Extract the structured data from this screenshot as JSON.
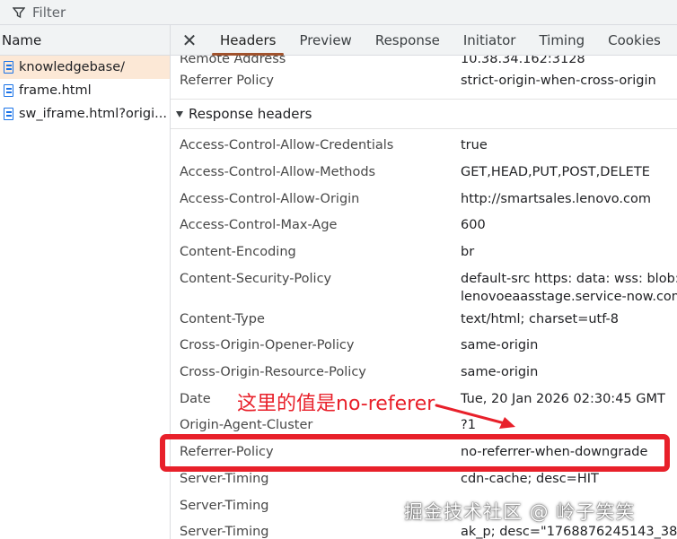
{
  "filter": {
    "placeholder": "Filter"
  },
  "requests": {
    "header": "Name",
    "items": [
      {
        "label": "knowledgebase/"
      },
      {
        "label": "frame.html"
      },
      {
        "label": "sw_iframe.html?origi..."
      }
    ]
  },
  "tabs": [
    "Headers",
    "Preview",
    "Response",
    "Initiator",
    "Timing",
    "Cookies"
  ],
  "general": [
    {
      "name": "Remote Address",
      "value": "10.38.34.162:3128"
    },
    {
      "name": "Referrer Policy",
      "value": "strict-origin-when-cross-origin"
    }
  ],
  "response_section": {
    "title": "Response headers"
  },
  "response_headers": [
    {
      "name": "Access-Control-Allow-Credentials",
      "value": "true"
    },
    {
      "name": "Access-Control-Allow-Methods",
      "value": "GET,HEAD,PUT,POST,DELETE"
    },
    {
      "name": "Access-Control-Allow-Origin",
      "value": "http://smartsales.lenovo.com"
    },
    {
      "name": "Access-Control-Max-Age",
      "value": "600"
    },
    {
      "name": "Content-Encoding",
      "value": "br"
    },
    {
      "name": "Content-Security-Policy",
      "value": "default-src https: data: wss: blob: '",
      "value2": "lenovoeaasstage.service-now.com"
    },
    {
      "name": "Content-Type",
      "value": "text/html; charset=utf-8"
    },
    {
      "name": "Cross-Origin-Opener-Policy",
      "value": "same-origin"
    },
    {
      "name": "Cross-Origin-Resource-Policy",
      "value": "same-origin"
    },
    {
      "name": "Date",
      "value": "Tue, 20 Jan 2026 02:30:45 GMT"
    },
    {
      "name": "Origin-Agent-Cluster",
      "value": "?1"
    },
    {
      "name": "Referrer-Policy",
      "value": "no-referrer-when-downgrade"
    },
    {
      "name": "Server-Timing",
      "value": "cdn-cache; desc=HIT"
    },
    {
      "name": "Server-Timing",
      "value": ""
    },
    {
      "name": "Server-Timing",
      "value": "ak_p; desc=\"1768876245143_3860"
    }
  ],
  "annotation": {
    "text": "这里的值是no-referer",
    "color": "#e8202a"
  },
  "watermark": {
    "text": "掘金技术社区 @ 岭子笑笑"
  },
  "colors": {
    "accent": "#a0522d",
    "selected_row": "#fce8d6",
    "icon_blue": "#1a73e8"
  }
}
